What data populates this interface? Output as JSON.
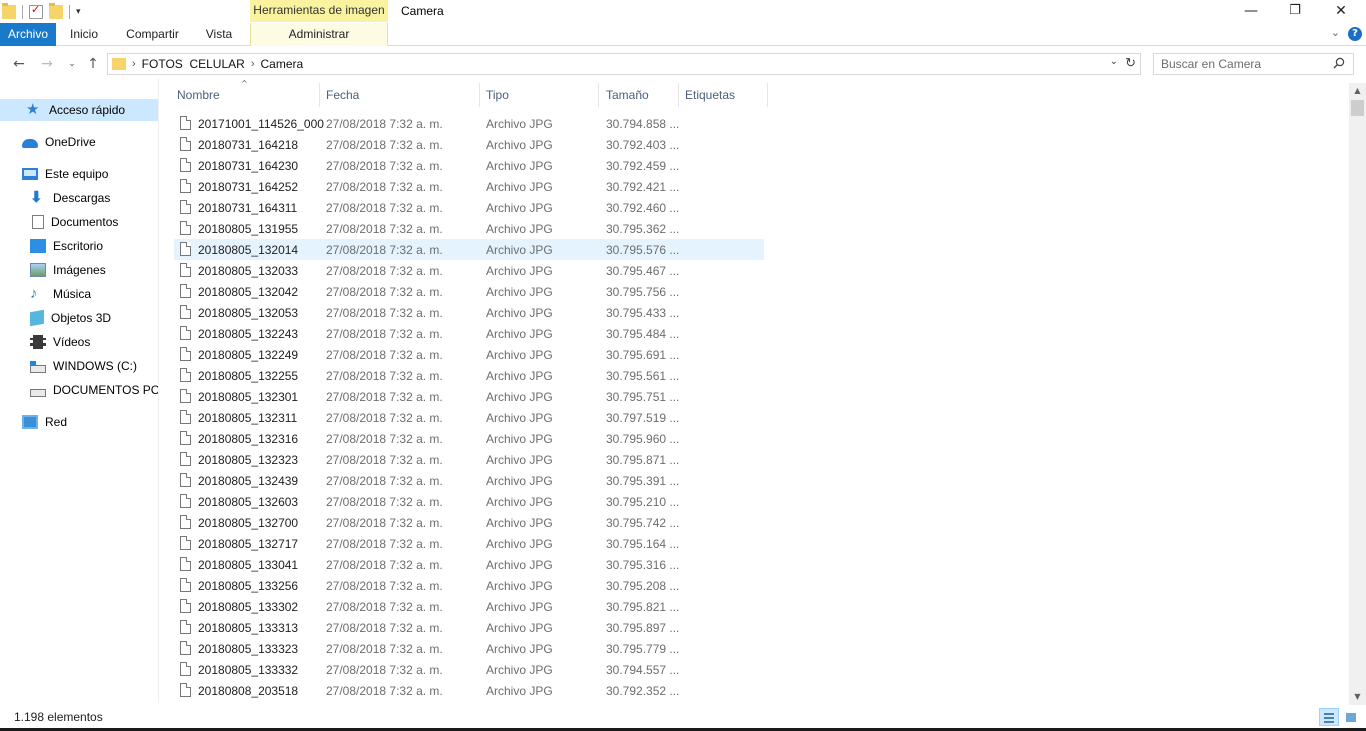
{
  "window": {
    "title": "Camera",
    "context_tab_header": "Herramientas de imagen",
    "controls": {
      "minimize": "—",
      "maximize": "❐",
      "close": "✕"
    }
  },
  "ribbon": {
    "tabs": [
      "Archivo",
      "Inicio",
      "Compartir",
      "Vista",
      "Administrar"
    ],
    "help": "?"
  },
  "address": {
    "crumbs": [
      "FOTOS  CELULAR",
      "Camera"
    ],
    "search_placeholder": "Buscar en Camera"
  },
  "sidebar": {
    "items": [
      {
        "label": "Acceso rápido",
        "icon": "star-icon"
      },
      {
        "label": "OneDrive",
        "icon": "cloud-icon"
      },
      {
        "label": "Este equipo",
        "icon": "computer-icon"
      },
      {
        "label": "Descargas",
        "icon": "download-icon"
      },
      {
        "label": "Documentos",
        "icon": "document-icon"
      },
      {
        "label": "Escritorio",
        "icon": "desktop-icon"
      },
      {
        "label": "Imágenes",
        "icon": "pictures-icon"
      },
      {
        "label": "Música",
        "icon": "music-icon"
      },
      {
        "label": "Objetos 3D",
        "icon": "3d-objects-icon"
      },
      {
        "label": "Vídeos",
        "icon": "videos-icon"
      },
      {
        "label": "WINDOWS (C:)",
        "icon": "windows-drive-icon"
      },
      {
        "label": "DOCUMENTOS PC (",
        "icon": "drive-icon"
      },
      {
        "label": "Red",
        "icon": "network-icon"
      }
    ]
  },
  "columns": [
    "Nombre",
    "Fecha",
    "Tipo",
    "Tamaño",
    "Etiquetas"
  ],
  "files": [
    {
      "name": "20171001_114526_000",
      "date": "27/08/2018 7:32 a. m.",
      "type": "Archivo JPG",
      "size": "30.794.858 ..."
    },
    {
      "name": "20180731_164218",
      "date": "27/08/2018 7:32 a. m.",
      "type": "Archivo JPG",
      "size": "30.792.403 ..."
    },
    {
      "name": "20180731_164230",
      "date": "27/08/2018 7:32 a. m.",
      "type": "Archivo JPG",
      "size": "30.792.459 ..."
    },
    {
      "name": "20180731_164252",
      "date": "27/08/2018 7:32 a. m.",
      "type": "Archivo JPG",
      "size": "30.792.421 ..."
    },
    {
      "name": "20180731_164311",
      "date": "27/08/2018 7:32 a. m.",
      "type": "Archivo JPG",
      "size": "30.792.460 ..."
    },
    {
      "name": "20180805_131955",
      "date": "27/08/2018 7:32 a. m.",
      "type": "Archivo JPG",
      "size": "30.795.362 ..."
    },
    {
      "name": "20180805_132014",
      "date": "27/08/2018 7:32 a. m.",
      "type": "Archivo JPG",
      "size": "30.795.576 ..."
    },
    {
      "name": "20180805_132033",
      "date": "27/08/2018 7:32 a. m.",
      "type": "Archivo JPG",
      "size": "30.795.467 ..."
    },
    {
      "name": "20180805_132042",
      "date": "27/08/2018 7:32 a. m.",
      "type": "Archivo JPG",
      "size": "30.795.756 ..."
    },
    {
      "name": "20180805_132053",
      "date": "27/08/2018 7:32 a. m.",
      "type": "Archivo JPG",
      "size": "30.795.433 ..."
    },
    {
      "name": "20180805_132243",
      "date": "27/08/2018 7:32 a. m.",
      "type": "Archivo JPG",
      "size": "30.795.484 ..."
    },
    {
      "name": "20180805_132249",
      "date": "27/08/2018 7:32 a. m.",
      "type": "Archivo JPG",
      "size": "30.795.691 ..."
    },
    {
      "name": "20180805_132255",
      "date": "27/08/2018 7:32 a. m.",
      "type": "Archivo JPG",
      "size": "30.795.561 ..."
    },
    {
      "name": "20180805_132301",
      "date": "27/08/2018 7:32 a. m.",
      "type": "Archivo JPG",
      "size": "30.795.751 ..."
    },
    {
      "name": "20180805_132311",
      "date": "27/08/2018 7:32 a. m.",
      "type": "Archivo JPG",
      "size": "30.797.519 ..."
    },
    {
      "name": "20180805_132316",
      "date": "27/08/2018 7:32 a. m.",
      "type": "Archivo JPG",
      "size": "30.795.960 ..."
    },
    {
      "name": "20180805_132323",
      "date": "27/08/2018 7:32 a. m.",
      "type": "Archivo JPG",
      "size": "30.795.871 ..."
    },
    {
      "name": "20180805_132439",
      "date": "27/08/2018 7:32 a. m.",
      "type": "Archivo JPG",
      "size": "30.795.391 ..."
    },
    {
      "name": "20180805_132603",
      "date": "27/08/2018 7:32 a. m.",
      "type": "Archivo JPG",
      "size": "30.795.210 ..."
    },
    {
      "name": "20180805_132700",
      "date": "27/08/2018 7:32 a. m.",
      "type": "Archivo JPG",
      "size": "30.795.742 ..."
    },
    {
      "name": "20180805_132717",
      "date": "27/08/2018 7:32 a. m.",
      "type": "Archivo JPG",
      "size": "30.795.164 ..."
    },
    {
      "name": "20180805_133041",
      "date": "27/08/2018 7:32 a. m.",
      "type": "Archivo JPG",
      "size": "30.795.316 ..."
    },
    {
      "name": "20180805_133256",
      "date": "27/08/2018 7:32 a. m.",
      "type": "Archivo JPG",
      "size": "30.795.208 ..."
    },
    {
      "name": "20180805_133302",
      "date": "27/08/2018 7:32 a. m.",
      "type": "Archivo JPG",
      "size": "30.795.821 ..."
    },
    {
      "name": "20180805_133313",
      "date": "27/08/2018 7:32 a. m.",
      "type": "Archivo JPG",
      "size": "30.795.897 ..."
    },
    {
      "name": "20180805_133323",
      "date": "27/08/2018 7:32 a. m.",
      "type": "Archivo JPG",
      "size": "30.795.779 ..."
    },
    {
      "name": "20180805_133332",
      "date": "27/08/2018 7:32 a. m.",
      "type": "Archivo JPG",
      "size": "30.794.557 ..."
    },
    {
      "name": "20180808_203518",
      "date": "27/08/2018 7:32 a. m.",
      "type": "Archivo JPG",
      "size": "30.792.352 ..."
    }
  ],
  "hovered_file": "20180805_132014",
  "status": {
    "item_count": "1.198 elementos"
  },
  "colors": {
    "accent": "#1979ca",
    "selection": "#cce8ff",
    "hover": "#e5f3ff",
    "context_tab": "#f9f29f"
  }
}
